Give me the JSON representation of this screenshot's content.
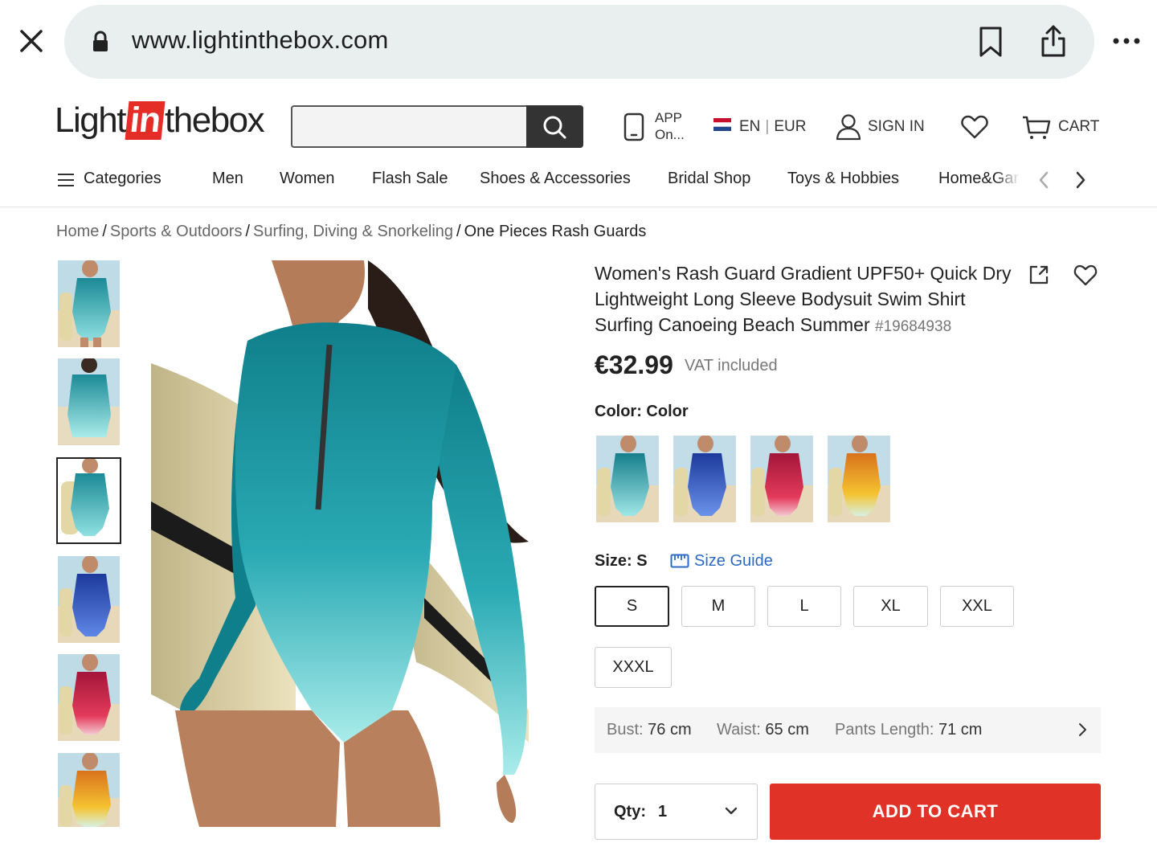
{
  "browser": {
    "url": "www.lightinthebox.com"
  },
  "header": {
    "logo": {
      "part1": "Light",
      "part2": "in",
      "part3": "thebox"
    },
    "app_line1": "APP",
    "app_line2": "On...",
    "language": "EN",
    "currency": "EUR",
    "sign_in": "SIGN IN",
    "cart": "CART"
  },
  "nav": {
    "categories": "Categories",
    "items": [
      "Men",
      "Women",
      "Flash Sale",
      "Shoes & Accessories",
      "Bridal Shop",
      "Toys & Hobbies",
      "Home&Garden"
    ]
  },
  "breadcrumb": {
    "items": [
      "Home",
      "Sports & Outdoors",
      "Surfing, Diving & Snorkeling",
      "One Pieces Rash Guards"
    ],
    "separator": "/"
  },
  "product": {
    "title": "Women's Rash Guard Gradient UPF50+ Quick Dry Lightweight Long Sleeve Bodysuit Swim Shirt Surfing Canoeing Beach Summer",
    "sku": "#19684938",
    "price": "€32.99",
    "vat": "VAT included",
    "color_label": "Color: Color",
    "size_label": "Size: S",
    "size_guide": "Size Guide",
    "sizes": [
      "S",
      "M",
      "L",
      "XL",
      "XXL",
      "XXXL"
    ],
    "selected_size": "S",
    "swatch_colors": [
      "teal",
      "blue",
      "red",
      "orange"
    ],
    "measurements": {
      "bust_label": "Bust:",
      "bust_value": "76 cm",
      "waist_label": "Waist:",
      "waist_value": "65 cm",
      "pants_label": "Pants Length:",
      "pants_value": "71 cm"
    },
    "qty_label": "Qty:",
    "qty_value": "1",
    "add_to_cart": "ADD TO CART"
  },
  "colors": {
    "accent_red": "#e03226",
    "link_blue": "#2b6bc4",
    "teal": "#1f9aa8",
    "blue": "#2a4fb8",
    "red": "#c1213f",
    "orange": "#e08a2a"
  }
}
